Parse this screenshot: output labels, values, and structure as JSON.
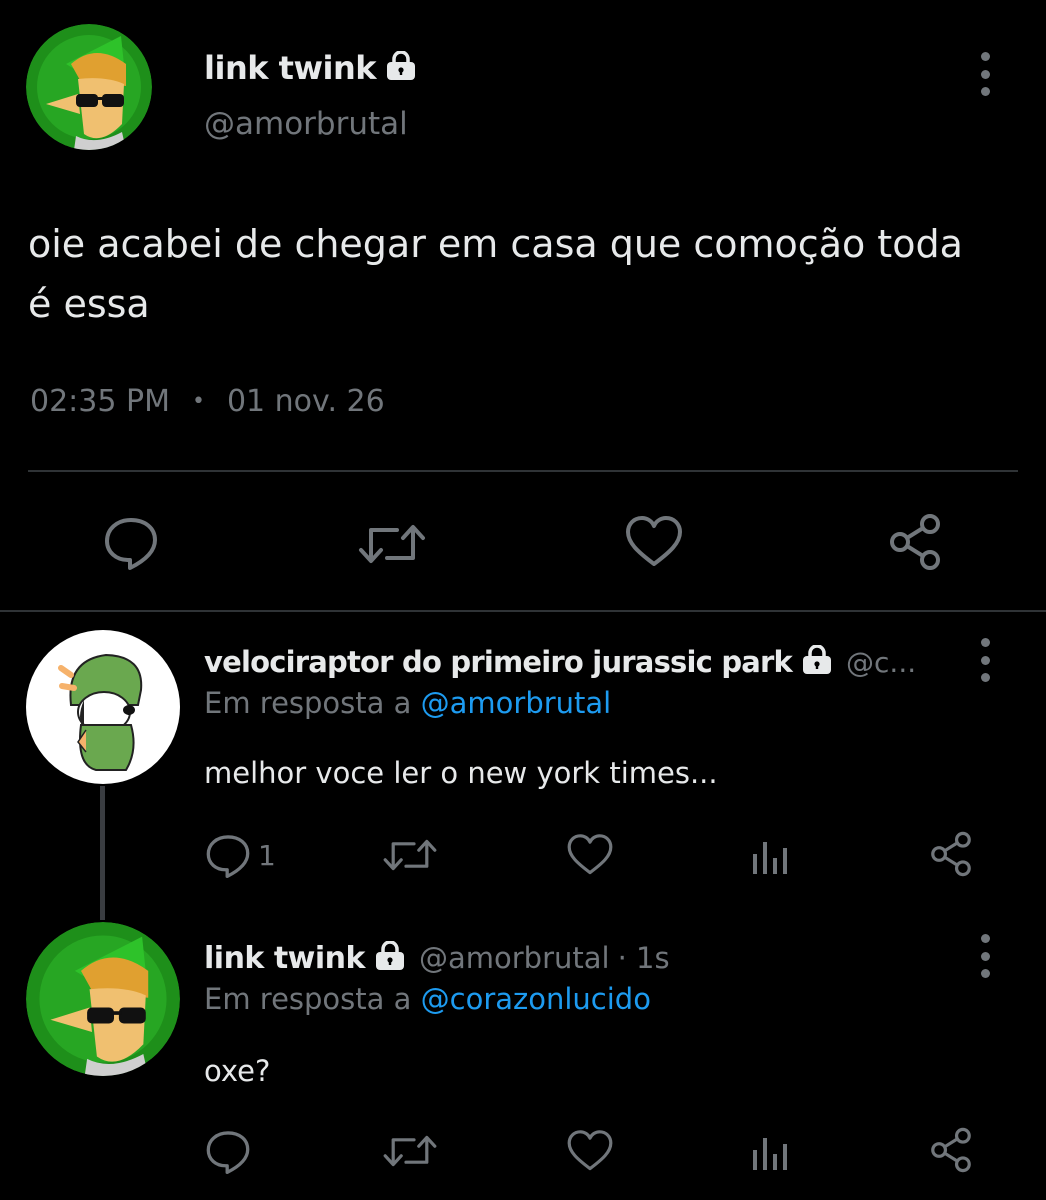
{
  "main_tweet": {
    "display_name": "link twink",
    "handle": "@amorbrutal",
    "text_line1": "oie acabei de chegar em casa que comoção toda",
    "text_line2": "é essa",
    "time": "02:35 PM",
    "separator": "•",
    "date": "01 nov. 26"
  },
  "reply_1": {
    "display_name": "velociraptor do primeiro jurassic park",
    "handle": "@c...",
    "replying_prefix": "Em resposta a",
    "replying_to": "@amorbrutal",
    "text": "melhor voce ler o new york times...",
    "reply_count": "1"
  },
  "reply_2": {
    "display_name": "link twink",
    "handle": "@amorbrutal",
    "time_ago": "· 1s",
    "replying_prefix": "Em resposta a",
    "replying_to": "@corazonlucido",
    "text": "oxe?"
  },
  "colors": {
    "background": "#000000",
    "text": "#e7e9ea",
    "muted": "#71767b",
    "link": "#1d9bf0",
    "divider": "#2f3336"
  }
}
